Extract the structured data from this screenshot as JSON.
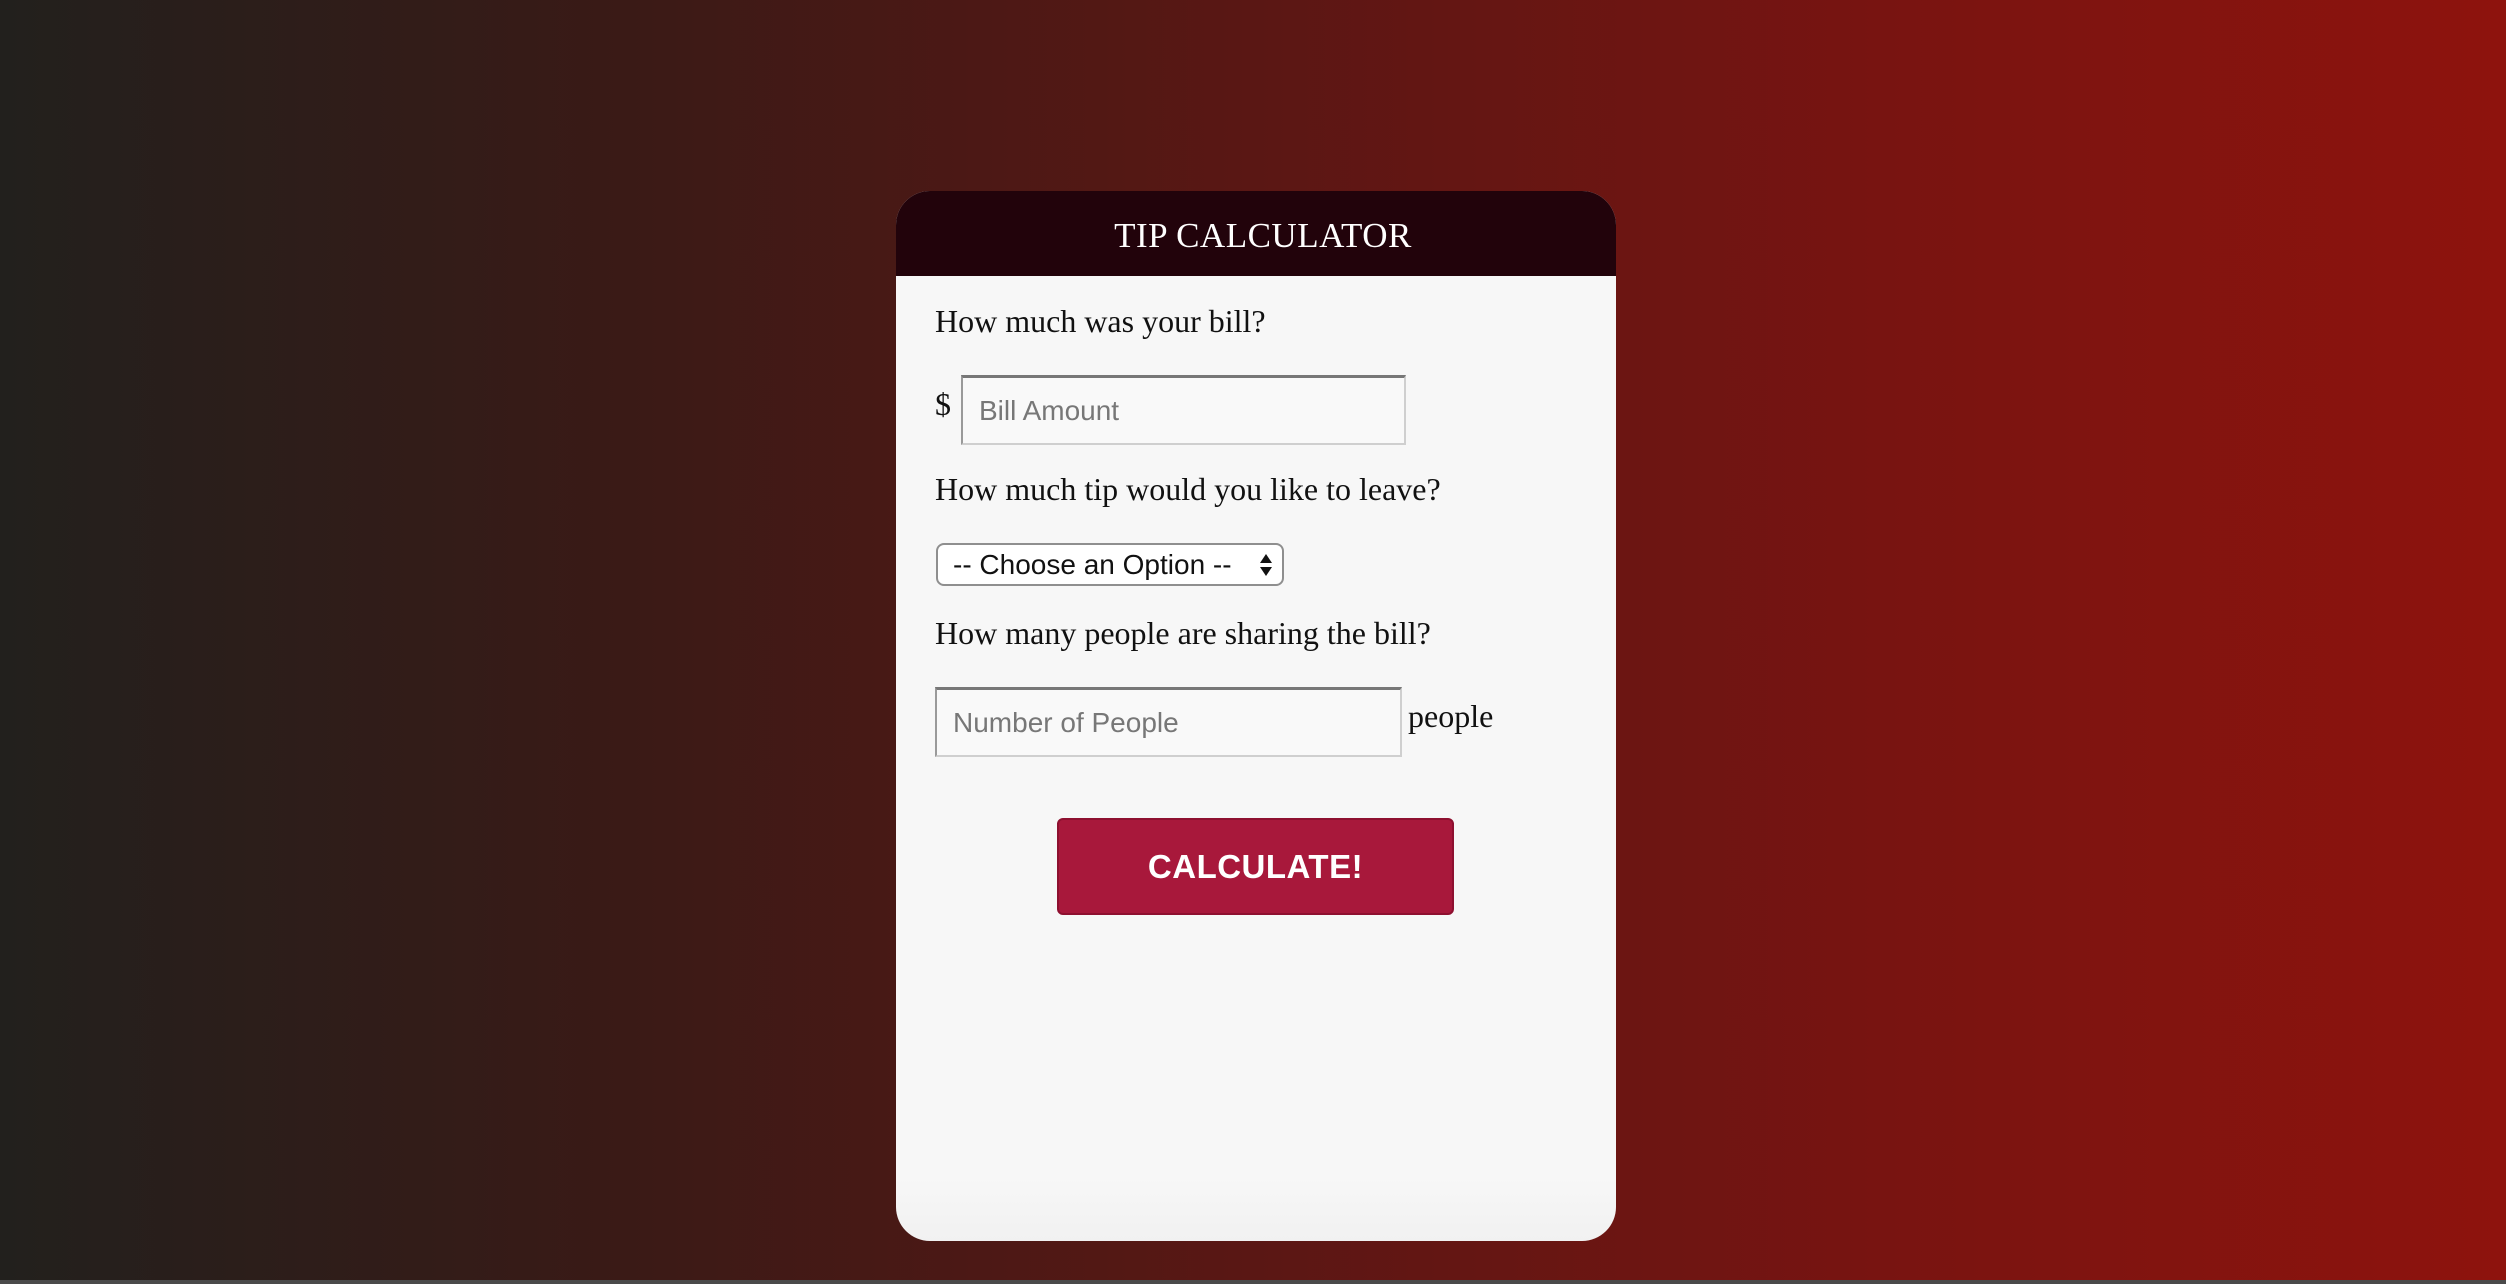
{
  "header": {
    "title": "TIP CALCULATOR"
  },
  "bill": {
    "question": "How much was your bill?",
    "currency_symbol": "$",
    "placeholder": "Bill Amount",
    "value": ""
  },
  "tip": {
    "question": "How much tip would you like to leave?",
    "selected_option": "-- Choose an Option --"
  },
  "people": {
    "question": "How many people are sharing the bill?",
    "placeholder": "Number of People",
    "value": "",
    "unit_label": "people"
  },
  "actions": {
    "calculate_label": "CALCULATE!"
  },
  "colors": {
    "header_bg": "#22030b",
    "button_bg": "#a8183b",
    "card_bg": "#f7f7f7"
  }
}
